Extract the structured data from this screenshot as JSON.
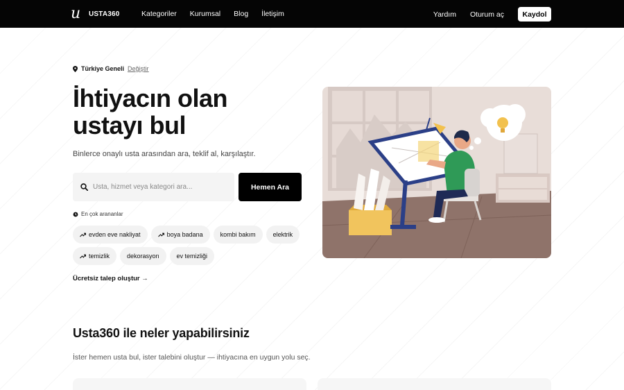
{
  "header": {
    "logo_mark": "u",
    "logo_text": "USTA360",
    "nav": [
      "Kategoriler",
      "Kurumsal",
      "Blog",
      "İletişim"
    ],
    "help": "Yardım",
    "login": "Oturum aç",
    "signup": "Kaydol"
  },
  "hero": {
    "location": {
      "name": "Türkiye Geneli",
      "change": "Değiştir"
    },
    "title": "İhtiyacın olan ustayı bul",
    "subtitle": "Binlerce onaylı usta arasından ara, teklif al, karşılaştır.",
    "search": {
      "placeholder": "Usta, hizmet veya kategori ara...",
      "button": "Hemen Ara"
    },
    "popular_label": "En çok arananlar",
    "tags_row1": [
      {
        "label": "evden eve nakliyat",
        "icon": "trend-up-icon"
      },
      {
        "label": "boya badana",
        "icon": "trend-up-icon"
      },
      {
        "label": "kombi bakım"
      },
      {
        "label": "elektrik"
      }
    ],
    "tags_row2": [
      {
        "label": "temizlik",
        "icon": "trend-up-icon"
      },
      {
        "label": "dekorasyon"
      },
      {
        "label": "ev temizliği"
      }
    ],
    "free_request": "Ücretsiz talep oluştur →"
  },
  "features": {
    "title": "Usta360 ile neler yapabilirsiniz",
    "subtitle": "İster hemen usta bul, ister talebini oluştur — ihtiyacına en uygun yolu seç."
  },
  "colors": {
    "header_bg": "#050505",
    "accent": "#000000",
    "illus_wall": "#e6dbd6",
    "illus_floor": "#8d7166",
    "illus_shirt": "#2f9a57",
    "illus_table": "#2b3f87",
    "illus_lamp": "#f2c14e"
  }
}
